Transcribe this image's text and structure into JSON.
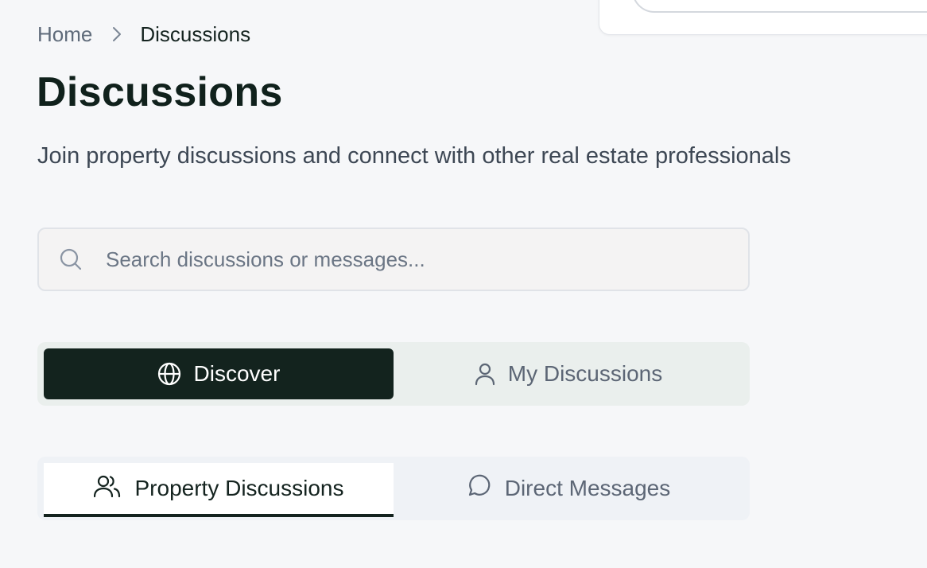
{
  "breadcrumb": {
    "home": "Home",
    "separator_icon": "chevron-right-icon",
    "current": "Discussions"
  },
  "page": {
    "title": "Discussions",
    "subtitle": "Join property discussions and connect with other real estate professionals"
  },
  "search": {
    "icon": "search-icon",
    "value": "",
    "placeholder": "Search discussions or messages..."
  },
  "view_toggle": {
    "selected": "Discover",
    "options": [
      {
        "label": "Discover",
        "icon": "globe-icon",
        "active": true
      },
      {
        "label": "My Discussions",
        "icon": "user-icon",
        "active": false
      }
    ]
  },
  "tabs": {
    "selected": "Property Discussions",
    "items": [
      {
        "label": "Property Discussions",
        "icon": "users-icon",
        "active": true
      },
      {
        "label": "Direct Messages",
        "icon": "message-circle-icon",
        "active": false
      }
    ]
  },
  "colors": {
    "background": "#f6f7f9",
    "primary_dark": "#13231e",
    "muted_text": "#5c6675",
    "toggle_track": "#eaefed",
    "tabs_track": "#eff2f6"
  }
}
